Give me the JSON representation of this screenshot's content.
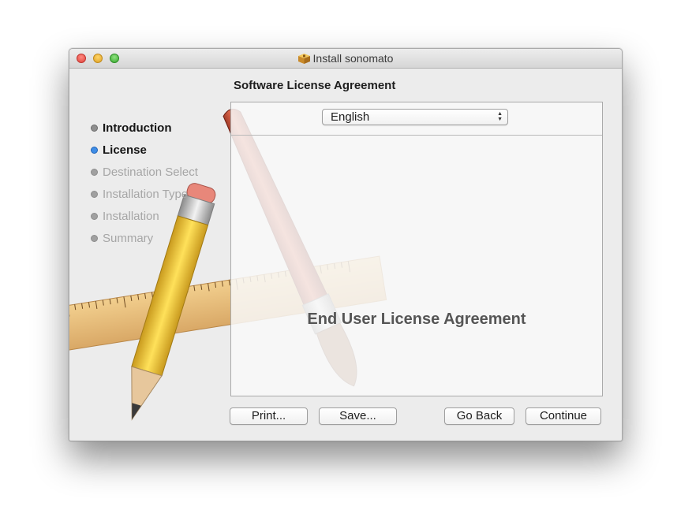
{
  "window": {
    "title": "Install sonomato"
  },
  "page_title": "Software License Agreement",
  "steps": [
    {
      "label": "Introduction",
      "state": "done"
    },
    {
      "label": "License",
      "state": "current"
    },
    {
      "label": "Destination Select",
      "state": "future"
    },
    {
      "label": "Installation Type",
      "state": "future"
    },
    {
      "label": "Installation",
      "state": "future"
    },
    {
      "label": "Summary",
      "state": "future"
    }
  ],
  "language_select": {
    "value": "English"
  },
  "license_body": "End User License Agreement",
  "buttons": {
    "print": "Print...",
    "save": "Save...",
    "go_back": "Go Back",
    "continue": "Continue"
  },
  "colors": {
    "current_step": "#3e8de6",
    "window_bg": "#ececec"
  }
}
